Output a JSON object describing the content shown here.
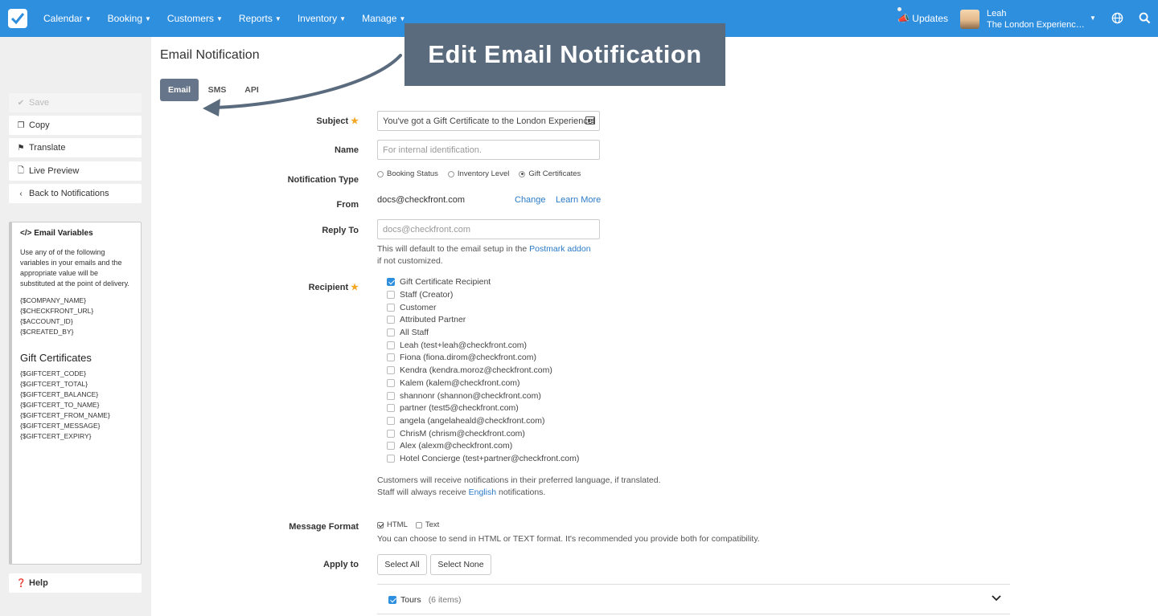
{
  "nav": {
    "items": [
      "Calendar",
      "Booking",
      "Customers",
      "Reports",
      "Inventory",
      "Manage"
    ],
    "updates_label": "Updates",
    "user_name": "Leah",
    "user_company": "The London Experience Ltd.",
    "accent": "#2f8fdf"
  },
  "sidebar": {
    "save": "Save",
    "copy": "Copy",
    "translate": "Translate",
    "live_preview": "Live Preview",
    "back": "Back to Notifications",
    "help": "Help",
    "vars_title": "Email Variables",
    "vars_desc": "Use any of of the following variables in your emails and the appropriate value will be substituted at the point of delivery.",
    "vars": [
      "{$COMPANY_NAME}",
      "{$CHECKFRONT_URL}",
      "{$ACCOUNT_ID}",
      "{$CREATED_BY}"
    ],
    "gift_heading": "Gift Certificates",
    "gift_vars": [
      "{$GIFTCERT_CODE}",
      "{$GIFTCERT_TOTAL}",
      "{$GIFTCERT_BALANCE}",
      "{$GIFTCERT_TO_NAME}",
      "{$GIFTCERT_FROM_NAME}",
      "{$GIFTCERT_MESSAGE}",
      "{$GIFTCERT_EXPIRY}"
    ]
  },
  "page": {
    "title": "Email Notification",
    "tabs": [
      "Email",
      "SMS",
      "API"
    ],
    "callout": "Edit Email Notification"
  },
  "form": {
    "subject_label": "Subject",
    "subject_value": "You've got a Gift Certificate to the London Experience!",
    "name_label": "Name",
    "name_placeholder": "For internal identification.",
    "type_label": "Notification Type",
    "types": [
      "Booking Status",
      "Inventory Level",
      "Gift Certificates"
    ],
    "type_selected": "Gift Certificates",
    "from_label": "From",
    "from_value": "docs@checkfront.com",
    "change_link": "Change",
    "learn_more_link": "Learn More",
    "reply_label": "Reply To",
    "reply_placeholder": "docs@checkfront.com",
    "reply_help_1": "This will default to the email setup in the",
    "reply_help_link": "Postmark addon",
    "reply_help_2": "if not customized.",
    "recipient_label": "Recipient",
    "recipients": [
      "Gift Certificate Recipient",
      "Staff (Creator)",
      "Customer",
      "Attributed Partner",
      "All Staff",
      "Leah (test+leah@checkfront.com)",
      "Fiona (fiona.dirom@checkfront.com)",
      "Kendra (kendra.moroz@checkfront.com)",
      "Kalem (kalem@checkfront.com)",
      "shannonr (shannon@checkfront.com)",
      "partner (test5@checkfront.com)",
      "angela (angelaheald@checkfront.com)",
      "ChrisM (chrism@checkfront.com)",
      "Alex (alexm@checkfront.com)",
      "Hotel Concierge (test+partner@checkfront.com)"
    ],
    "recipients_checked": [
      "Gift Certificate Recipient"
    ],
    "lang_help_1": "Customers will receive notifications in their preferred language, if translated.",
    "lang_help_2a": "Staff will always receive",
    "lang_help_link": "English",
    "lang_help_2b": "notifications.",
    "format_label": "Message Format",
    "format_html": "HTML",
    "format_text": "Text",
    "format_help": "You can choose to send in HTML or TEXT format. It's recommended you provide both for compatibility.",
    "apply_label": "Apply to",
    "select_all": "Select All",
    "select_none": "Select None",
    "tours_label": "Tours",
    "tours_count": "(6 items)"
  }
}
